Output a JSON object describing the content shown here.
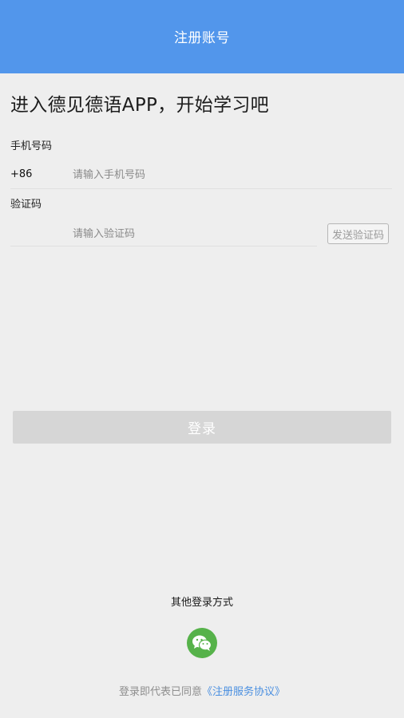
{
  "header": {
    "title": "注册账号"
  },
  "welcome": {
    "text": "进入德见德语APP，开始学习吧"
  },
  "phone": {
    "label": "手机号码",
    "country_code": "+86",
    "placeholder": "请输入手机号码",
    "value": ""
  },
  "code": {
    "label": "验证码",
    "placeholder": "请输入验证码",
    "value": "",
    "send_button": "发送验证码"
  },
  "login_button": "登录",
  "other_login": {
    "label": "其他登录方式",
    "icons": [
      "wechat-icon"
    ]
  },
  "agreement": {
    "prefix": "登录即代表已同意",
    "link": "《注册服务协议》"
  },
  "colors": {
    "header": "#5296eb",
    "background": "#eeeeee",
    "button_disabled": "#d6d6d6",
    "wechat": "#56b24a",
    "link": "#4a8fe0"
  }
}
